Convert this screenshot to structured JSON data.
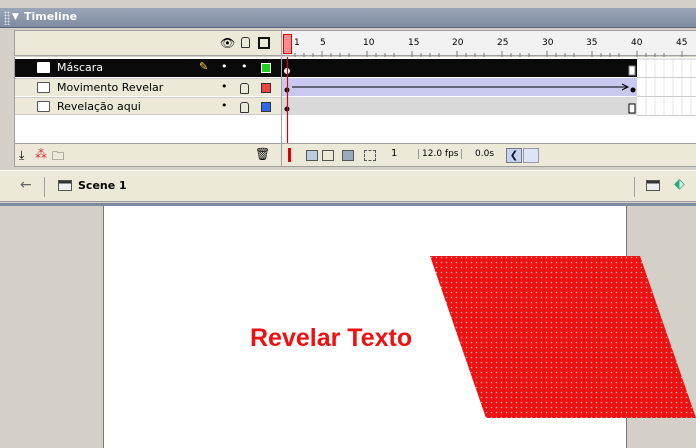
{
  "timeline": {
    "title": "Timeline",
    "frame_numbers": [
      "1",
      "5",
      "10",
      "15",
      "20",
      "25",
      "30",
      "35",
      "40",
      "45"
    ],
    "layers": [
      {
        "name": "Máscara",
        "selected": true,
        "color": "#22cc22"
      },
      {
        "name": "Movimento Revelar",
        "selected": false,
        "color": "#ee4444"
      },
      {
        "name": "Revelação aqui",
        "selected": false,
        "color": "#3366ee"
      }
    ],
    "status": {
      "current_frame": "1",
      "fps": "12.0 fps",
      "elapsed": "0.0s"
    }
  },
  "edit_bar": {
    "scene_name": "Scene 1"
  },
  "stage": {
    "text": "Revelar Texto",
    "text_color": "#ee1111",
    "shape_color": "#ee1111"
  }
}
